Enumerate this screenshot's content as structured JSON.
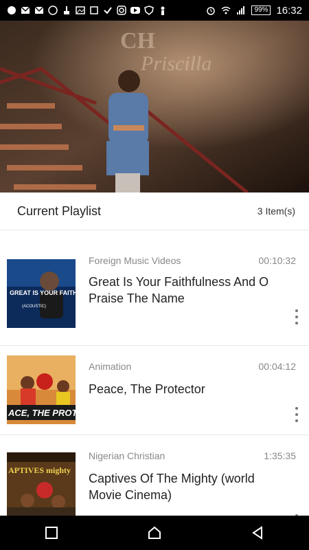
{
  "status_bar": {
    "time": "16:32",
    "battery": "99%"
  },
  "playlist": {
    "title": "Current Playlist",
    "count": "3 Item(s)",
    "items": [
      {
        "category": "Foreign Music Videos",
        "duration": "00:10:32",
        "title": "Great Is Your Faithfulness And O Praise The Name",
        "thumb_text": "GREAT IS YOUR FAITHFULNESS",
        "thumb_sub": "(ACOUSTIC)"
      },
      {
        "category": "Animation",
        "duration": "00:04:12",
        "title": "Peace, The Protector",
        "thumb_text": "ACE, THE PROTECT"
      },
      {
        "category": "Nigerian Christian",
        "duration": "1:35:35",
        "title": "Captives Of The Mighty (world Movie Cinema)",
        "thumb_text": "APTIVES mighty"
      }
    ]
  },
  "navbar": {
    "icons": [
      "recent-apps-icon",
      "home-icon",
      "back-icon"
    ]
  }
}
